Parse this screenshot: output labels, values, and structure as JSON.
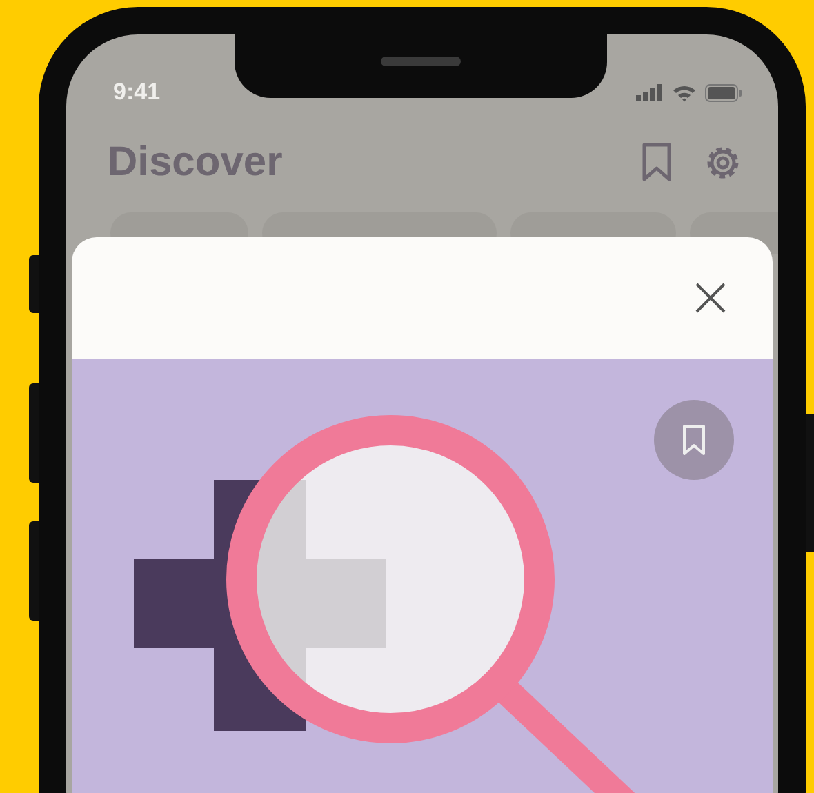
{
  "status_bar": {
    "time": "9:41"
  },
  "header": {
    "title": "Discover"
  }
}
